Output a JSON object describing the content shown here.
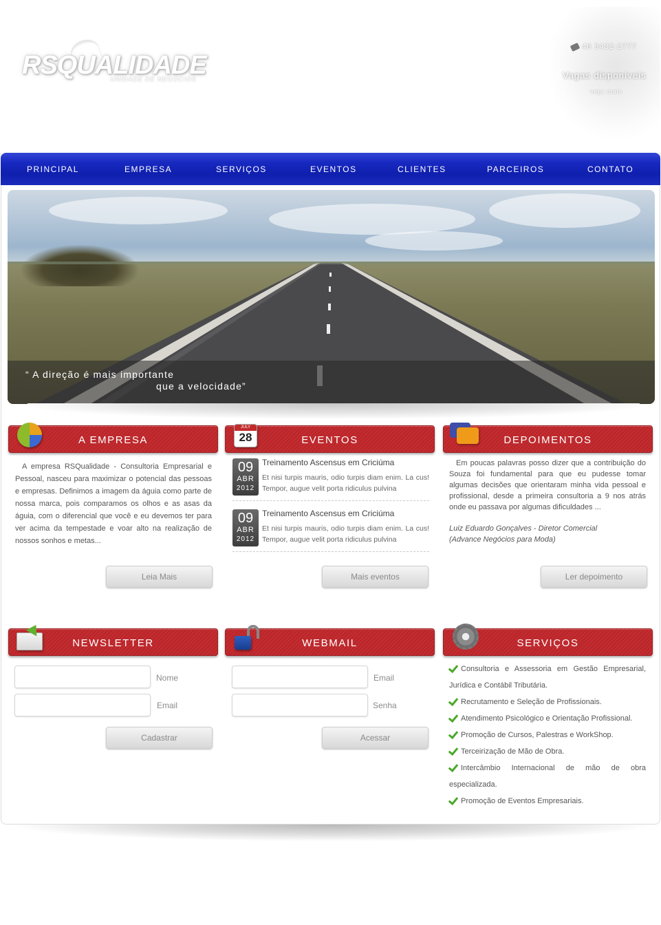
{
  "header": {
    "logo_text": "RSQUALIDADE",
    "logo_sub": "UNIDADE DE NEGÓCIOS",
    "phone": "48 3432-2777",
    "vagas": "Vagas disponíveis",
    "veja_mais": "veja mais"
  },
  "nav": {
    "items": [
      "PRINCIPAL",
      "EMPRESA",
      "SERVIÇOS",
      "EVENTOS",
      "CLIENTES",
      "PARCEIROS",
      "CONTATO"
    ],
    "color": "#1829c1"
  },
  "banner": {
    "quote_line1": "“ A direção é mais importante",
    "quote_line2": "que a velocidade”"
  },
  "empresa": {
    "title": "A EMPRESA",
    "text": "A empresa RSQualidade - Consultoria Empresarial e Pessoal, nasceu para maximizar o potencial das pessoas e empresas. Definimos a imagem da águia como parte de nossa marca, pois comparamos os olhos e as asas da águia, com o diferencial que você e eu devemos ter para ver acima da tempestade e voar alto na realização de nossos sonhos e metas...",
    "button": "Leia Mais"
  },
  "eventos": {
    "title": "EVENTOS",
    "icon_month": "JULY",
    "icon_day": "28",
    "items": [
      {
        "day": "09",
        "month": "ABR",
        "year": "2012",
        "title": "Treinamento Ascensus em Criciúma",
        "text": "Et nisi turpis mauris, odio turpis diam enim. La cus! Tempor, augue velit porta ridiculus pulvina"
      },
      {
        "day": "09",
        "month": "ABR",
        "year": "2012",
        "title": "Treinamento Ascensus em Criciúma",
        "text": "Et nisi turpis mauris, odio turpis diam enim. La cus! Tempor, augue velit porta ridiculus pulvina"
      }
    ],
    "button": "Mais eventos"
  },
  "depoimentos": {
    "title": "DEPOIMENTOS",
    "text": "Em poucas palavras posso dizer que a contribuição do Souza foi fundamental para que eu pudesse tomar algumas decisões que orientaram minha vida pessoal e profissional, desde a primeira consultoria a 9 nos atrás onde eu passava por algumas dificuldades ...",
    "author_line1": "Luiz Eduardo Gonçalves - Diretor Comercial",
    "author_line2": "(Advance Negócios para Moda)",
    "button": "Ler depoimento"
  },
  "newsletter": {
    "title": "NEWSLETTER",
    "label_nome": "Nome",
    "label_email": "Email",
    "nome_value": "",
    "email_value": "",
    "button": "Cadastrar"
  },
  "webmail": {
    "title": "WEBMAIL",
    "label_email": "Email",
    "label_senha": "Senha",
    "email_value": "",
    "senha_value": "",
    "button": "Acessar"
  },
  "servicos": {
    "title": "SERVIÇOS",
    "items": [
      "Consultoria e Assessoria em Gestão Empresarial, Jurídica e Contábil Tributária.",
      "Recrutamento e Seleção de Profissionais.",
      "Atendimento Psicológico e Orientação Profissional.",
      "Promoção de Cursos, Palestras e WorkShop.",
      "Terceirização de Mão de Obra.",
      "Intercâmbio Internacional de mão de obra especializada.",
      "Promoção de Eventos Empresariais."
    ]
  },
  "colors": {
    "header_red": "#c42d31",
    "nav_blue": "#1829c1",
    "check_green": "#4aa829"
  }
}
